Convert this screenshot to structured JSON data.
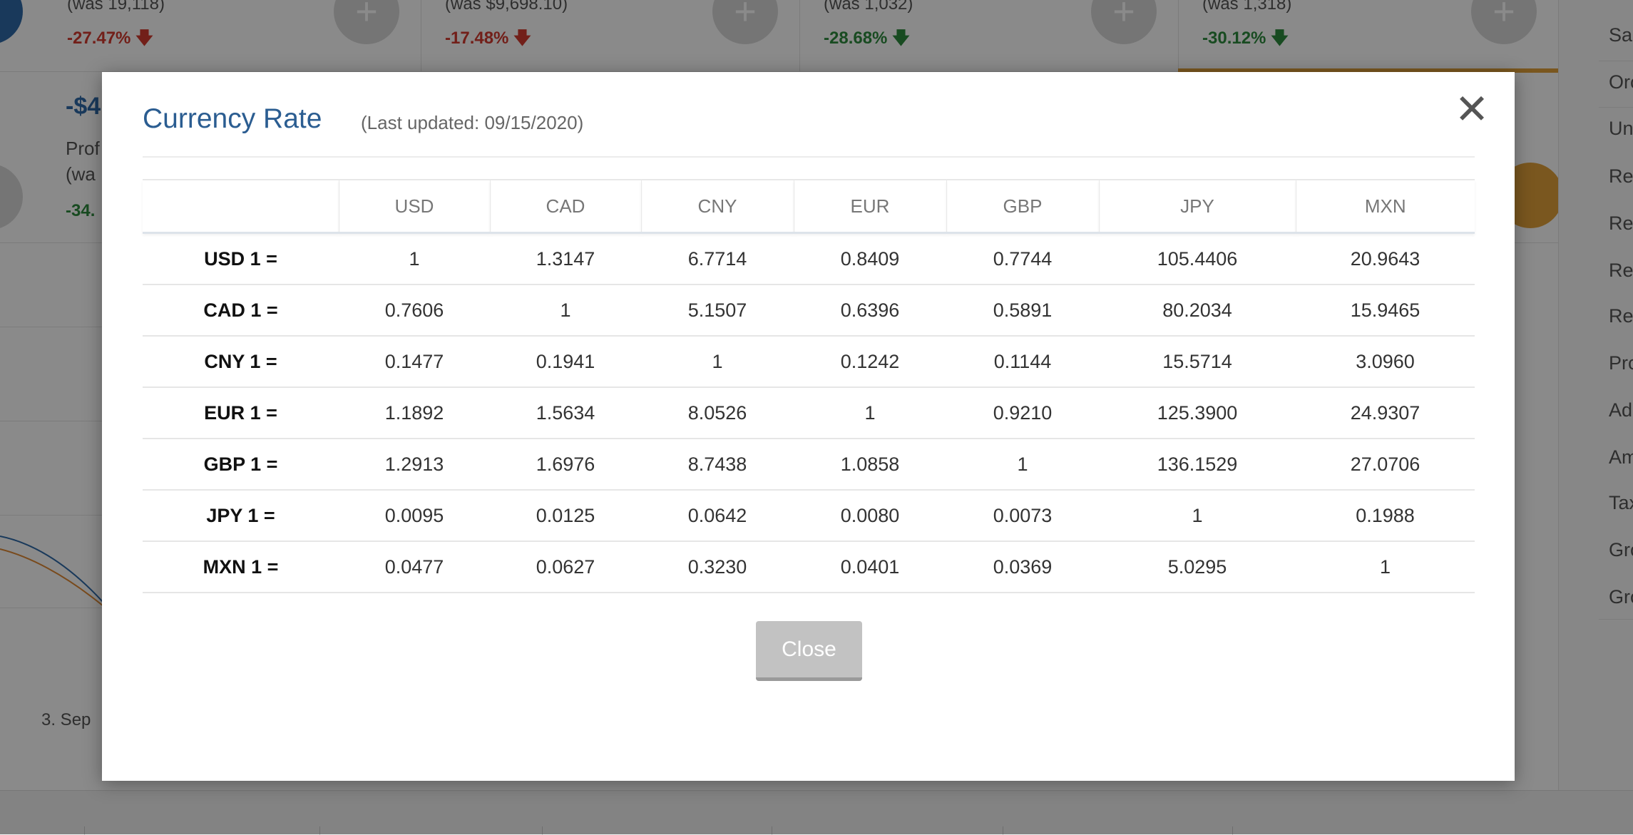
{
  "background": {
    "kpis": [
      {
        "was": "(was 19,118)",
        "pct": "-27.47%",
        "dir": "down"
      },
      {
        "was": "(was $9,698.10)",
        "pct": "-17.48%",
        "dir": "down"
      },
      {
        "was": "(was 1,032)",
        "pct": "-28.68%",
        "dir": "up"
      },
      {
        "was": "(was 1,318)",
        "pct": "-30.12%",
        "dir": "up"
      }
    ],
    "plus_glyph": "+",
    "arrow_down": "🡇",
    "profit_value": "-$4",
    "profit_label_1": "Prof",
    "profit_label_2": "(wa",
    "profit_pct": "-34.",
    "x_axis_label": "3. Sep",
    "sidebar_items": [
      "Sal",
      "Orc",
      "Un",
      "Rei",
      "Ret",
      "Ret",
      "Ret",
      "Prc",
      "Ad",
      "Am",
      "Tax",
      "Gro",
      "Gro"
    ],
    "colors": {
      "brand_blue": "#2f6aa8",
      "accent_orange": "#e2a23a",
      "down_red": "#d23a2f",
      "up_green": "#2e8b3e"
    }
  },
  "modal": {
    "title": "Currency Rate",
    "subtitle": "(Last updated: 09/15/2020)",
    "close_icon": "✕",
    "close_button": "Close",
    "title_color": "#2b5d91"
  },
  "rates_table": {
    "headers": [
      "",
      "USD",
      "CAD",
      "CNY",
      "EUR",
      "GBP",
      "JPY",
      "MXN"
    ],
    "rows": [
      {
        "label": "USD 1 =",
        "values": [
          "1",
          "1.3147",
          "6.7714",
          "0.8409",
          "0.7744",
          "105.4406",
          "20.9643"
        ]
      },
      {
        "label": "CAD 1 =",
        "values": [
          "0.7606",
          "1",
          "5.1507",
          "0.6396",
          "0.5891",
          "80.2034",
          "15.9465"
        ]
      },
      {
        "label": "CNY 1 =",
        "values": [
          "0.1477",
          "0.1941",
          "1",
          "0.1242",
          "0.1144",
          "15.5714",
          "3.0960"
        ]
      },
      {
        "label": "EUR 1 =",
        "values": [
          "1.1892",
          "1.5634",
          "8.0526",
          "1",
          "0.9210",
          "125.3900",
          "24.9307"
        ]
      },
      {
        "label": "GBP 1 =",
        "values": [
          "1.2913",
          "1.6976",
          "8.7438",
          "1.0858",
          "1",
          "136.1529",
          "27.0706"
        ]
      },
      {
        "label": "JPY 1 =",
        "values": [
          "0.0095",
          "0.0125",
          "0.0642",
          "0.0080",
          "0.0073",
          "1",
          "0.1988"
        ]
      },
      {
        "label": "MXN 1 =",
        "values": [
          "0.0477",
          "0.0627",
          "0.3230",
          "0.0401",
          "0.0369",
          "5.0295",
          "1"
        ]
      }
    ]
  }
}
